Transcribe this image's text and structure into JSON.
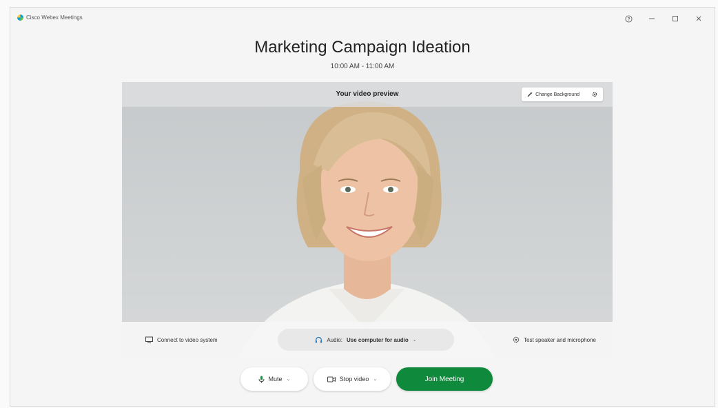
{
  "app": {
    "title": "Cisco Webex Meetings"
  },
  "meeting": {
    "title": "Marketing Campaign Ideation",
    "time": "10:00 AM - 11:00 AM"
  },
  "preview": {
    "label": "Your video preview",
    "change_background_label": "Change Background"
  },
  "controls": {
    "connect_video_label": "Connect to video system",
    "audio_prefix": "Audio:",
    "audio_value": "Use computer for audio",
    "test_label": "Test speaker and microphone"
  },
  "actions": {
    "mute_label": "Mute",
    "stop_video_label": "Stop video",
    "join_label": "Join Meeting"
  },
  "colors": {
    "join_button": "#0f8a3c",
    "window_bg": "#f5f5f5"
  },
  "icons": {
    "app": "webex-logo-icon",
    "help": "help-icon",
    "minimize": "minimize-icon",
    "maximize": "maximize-icon",
    "close": "close-icon",
    "change_background": "wand-icon",
    "settings": "gear-icon",
    "connect_video": "video-system-icon",
    "audio": "headset-icon",
    "test": "speaker-settings-icon",
    "mute": "microphone-icon",
    "stop_video": "camera-icon"
  }
}
